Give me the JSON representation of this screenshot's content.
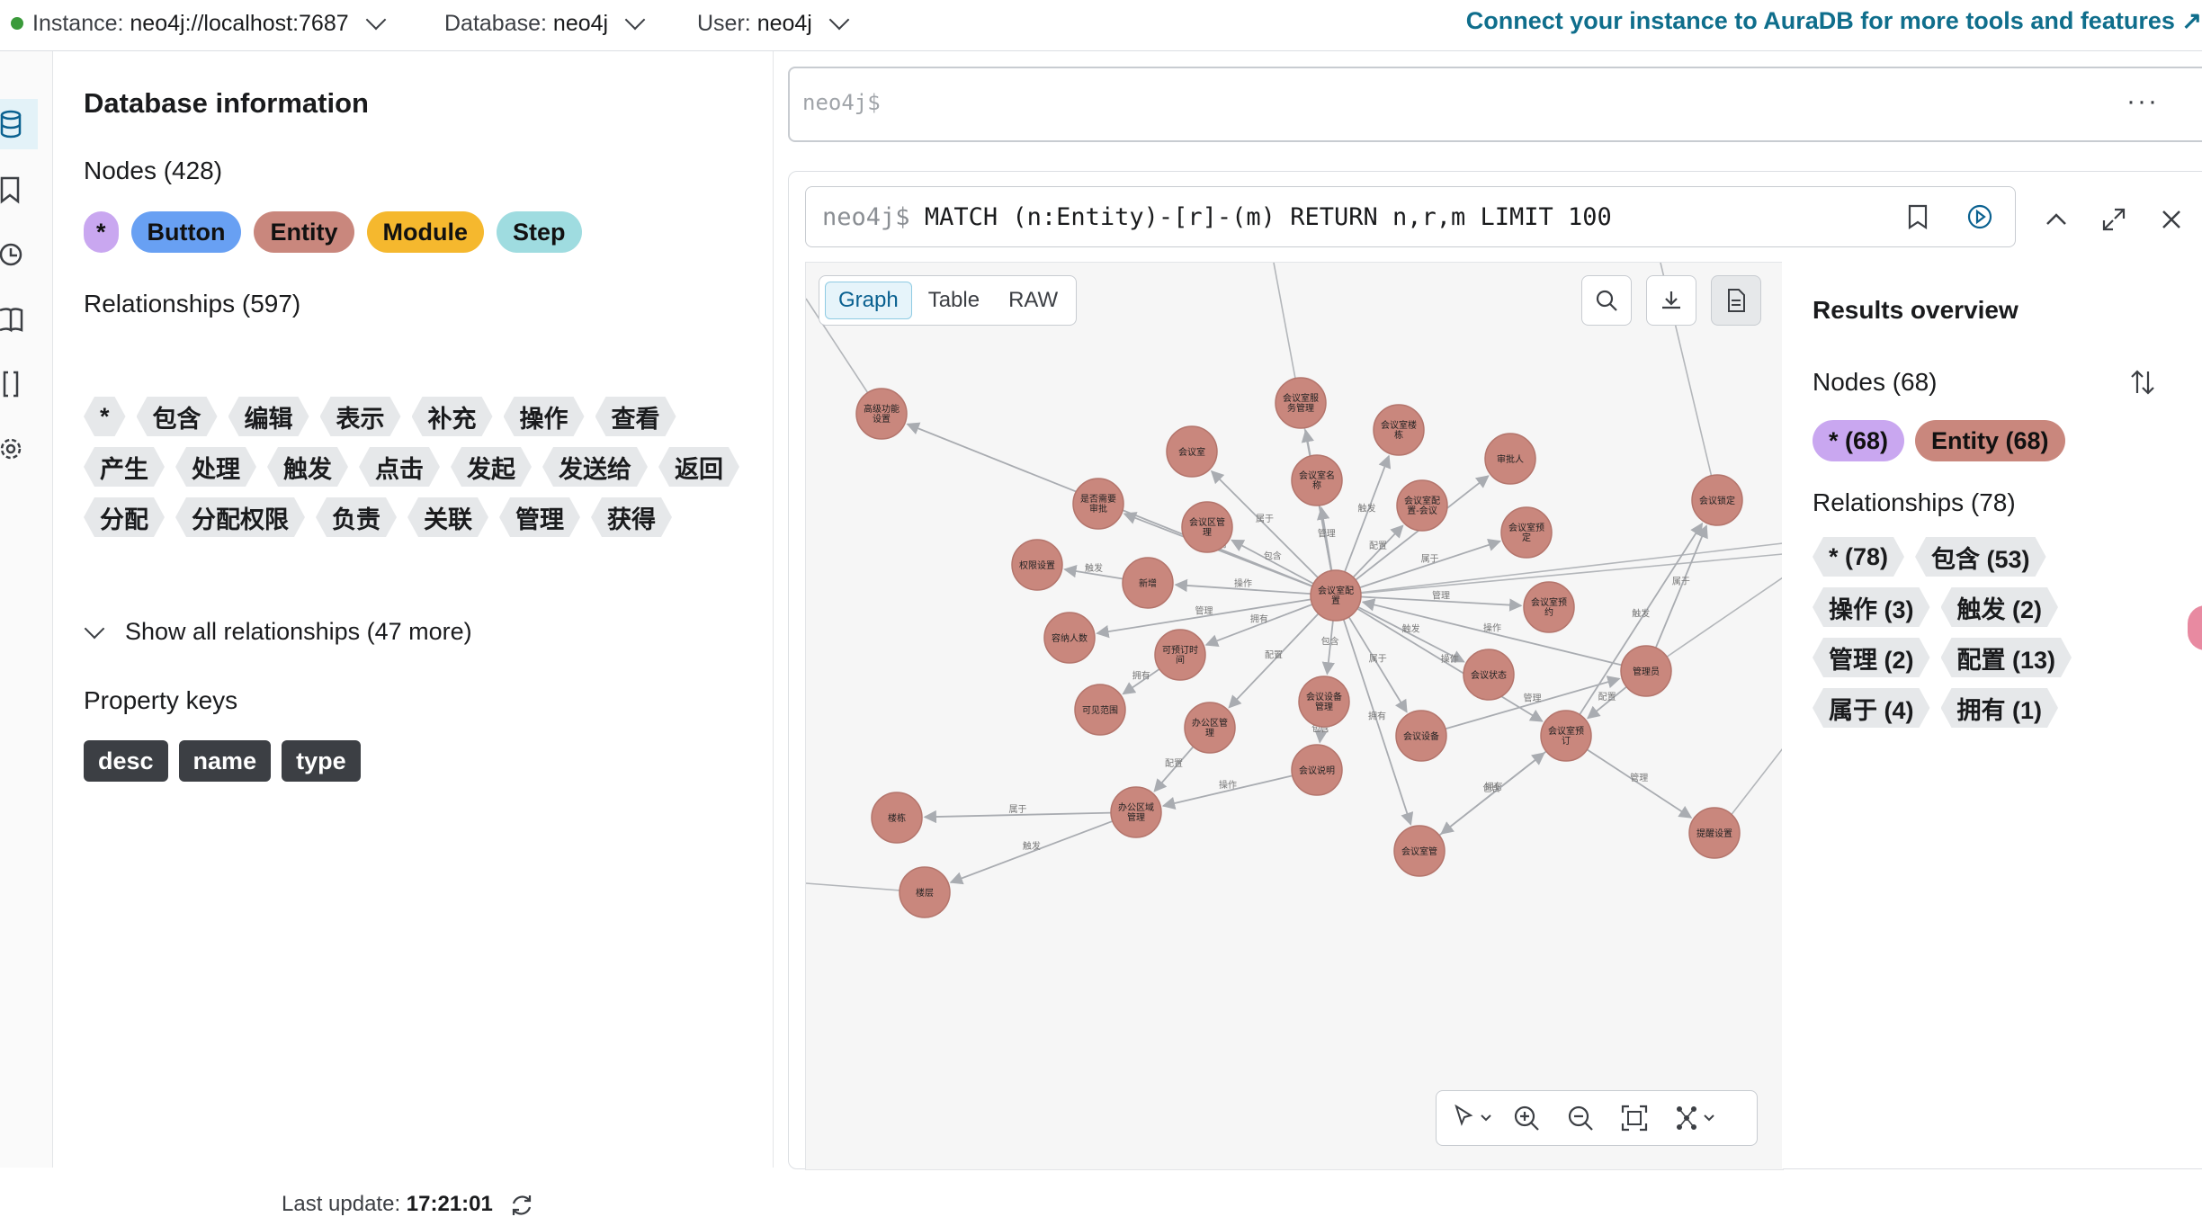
{
  "topbar": {
    "instance_label": "Instance:",
    "instance_value": "neo4j://localhost:7687",
    "database_label": "Database:",
    "database_value": "neo4j",
    "user_label": "User:",
    "user_value": "neo4j",
    "aura_link": "Connect your instance to AuraDB for more tools and features ↗",
    "status_color": "#3a9a3a"
  },
  "rail": {
    "icons": [
      "database-icon",
      "bookmark-icon",
      "history-icon",
      "book-icon",
      "braces-icon",
      "settings-icon"
    ]
  },
  "dbinfo": {
    "title": "Database information",
    "nodes_heading": "Nodes (428)",
    "node_labels": [
      {
        "label": "*",
        "color": "#c9a7f0"
      },
      {
        "label": "Button",
        "color": "#68a0f3"
      },
      {
        "label": "Entity",
        "color": "#c9877d"
      },
      {
        "label": "Module",
        "color": "#f5b82e"
      },
      {
        "label": "Step",
        "color": "#9fdce0"
      }
    ],
    "relationships_heading": "Relationships (597)",
    "relationship_types": [
      "*",
      "包含",
      "编辑",
      "表示",
      "补充",
      "操作",
      "查看",
      "产生",
      "处理",
      "触发",
      "点击",
      "发起",
      "发送给",
      "返回",
      "分配",
      "分配权限",
      "负责",
      "关联",
      "管理",
      "获得"
    ],
    "show_all": "Show all relationships (47 more)",
    "property_keys_heading": "Property keys",
    "property_keys": [
      "desc",
      "name",
      "type"
    ],
    "last_update_label": "Last update:",
    "last_update_time": "17:21:01"
  },
  "editor": {
    "prompt": "neo4j$",
    "more": "···"
  },
  "frame": {
    "prompt": "neo4j$",
    "query": "MATCH (n:Entity)-[r]-(m) RETURN n,r,m LIMIT 100",
    "tabs": [
      "Graph",
      "Table",
      "RAW"
    ],
    "active_tab": "Graph"
  },
  "graph": {
    "node_color": "#c9877d",
    "nodes": [
      {
        "id": "n1",
        "text": "高级功能设置"
      },
      {
        "id": "n2",
        "text": "会议室服务管理"
      },
      {
        "id": "n3",
        "text": "会议室"
      },
      {
        "id": "n4",
        "text": "会议室楼栋"
      },
      {
        "id": "n5",
        "text": "审批人"
      },
      {
        "id": "n6",
        "text": "会议锁定"
      },
      {
        "id": "n7",
        "text": "会议室名称"
      },
      {
        "id": "n8",
        "text": "是否需要审批"
      },
      {
        "id": "n9",
        "text": "会议区管理"
      },
      {
        "id": "n10",
        "text": "会议室配置-会议..."
      },
      {
        "id": "n11",
        "text": "会议室预定"
      },
      {
        "id": "n12",
        "text": "权限设置"
      },
      {
        "id": "n13",
        "text": "新增"
      },
      {
        "id": "n14",
        "text": "会议室配置"
      },
      {
        "id": "n15",
        "text": "会议室预约"
      },
      {
        "id": "n16",
        "text": "容纳人数"
      },
      {
        "id": "n17",
        "text": "可预订时间"
      },
      {
        "id": "n18",
        "text": "会议状态"
      },
      {
        "id": "n19",
        "text": "管理员"
      },
      {
        "id": "n20",
        "text": "会议设备管理"
      },
      {
        "id": "n21",
        "text": "可见范围"
      },
      {
        "id": "n22",
        "text": "办公区管理"
      },
      {
        "id": "n23",
        "text": "会议设备"
      },
      {
        "id": "n24",
        "text": "会议室预订"
      },
      {
        "id": "n25",
        "text": "会议说明"
      },
      {
        "id": "n26",
        "text": "楼栋"
      },
      {
        "id": "n27",
        "text": "办公区域管理"
      },
      {
        "id": "n28",
        "text": "提醒设置"
      },
      {
        "id": "n29",
        "text": "会议室管"
      },
      {
        "id": "n30",
        "text": "楼层"
      }
    ],
    "edge_labels": [
      "包含",
      "配置",
      "属于",
      "触发",
      "操作",
      "管理",
      "拥有"
    ]
  },
  "overview": {
    "title": "Results overview",
    "nodes_heading": "Nodes (68)",
    "node_chips": [
      {
        "label": "* (68)",
        "color": "#c9a7f0"
      },
      {
        "label": "Entity (68)",
        "color": "#c9877d"
      }
    ],
    "relationships_heading": "Relationships (78)",
    "rel_chips": [
      "* (78)",
      "包含 (53)",
      "操作 (3)",
      "触发 (2)",
      "管理 (2)",
      "配置 (13)",
      "属于 (4)",
      "拥有 (1)"
    ]
  }
}
